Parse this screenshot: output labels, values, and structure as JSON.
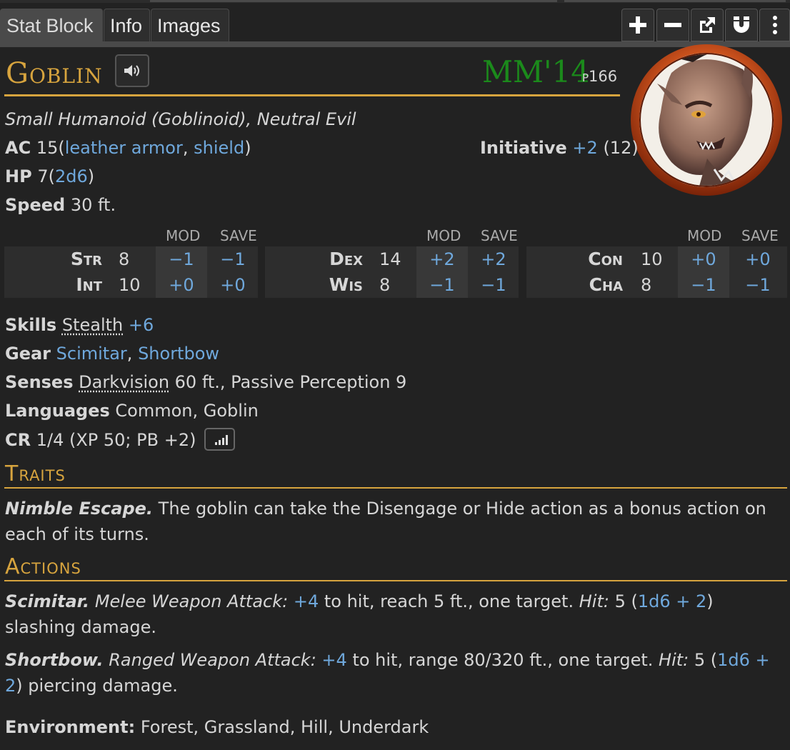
{
  "tabs": [
    {
      "label": "Stat Block"
    },
    {
      "label": "Info"
    },
    {
      "label": "Images"
    }
  ],
  "toolbar": [
    "plus-icon",
    "minus-icon",
    "popout-icon",
    "magnet-icon",
    "kebab-menu-icon"
  ],
  "header": {
    "name": "Goblin",
    "source": "MM'14",
    "page": "p166",
    "source_color": "#1b8a1b",
    "accent_color": "#d7a43e",
    "link_color": "#6fa8dc"
  },
  "type_line": "Small Humanoid (Goblinoid), Neutral Evil",
  "ac": {
    "label": "AC",
    "value": "15",
    "open": "(",
    "item1": "leather armor",
    "sep": ", ",
    "item2": "shield",
    "close": ")"
  },
  "initiative": {
    "label": "Initiative",
    "mod": "+2",
    "passive": "(12)"
  },
  "hp": {
    "label": "HP",
    "value": "7",
    "open": "(",
    "dice": "2d6",
    "close": ")"
  },
  "speed": {
    "label": "Speed",
    "value": "30 ft."
  },
  "ability_headers": {
    "mod": "MOD",
    "save": "SAVE"
  },
  "abilities": [
    [
      {
        "name": "Str",
        "score": "8",
        "mod": "−1",
        "save": "−1"
      },
      {
        "name": "Int",
        "score": "10",
        "mod": "+0",
        "save": "+0"
      }
    ],
    [
      {
        "name": "Dex",
        "score": "14",
        "mod": "+2",
        "save": "+2"
      },
      {
        "name": "Wis",
        "score": "8",
        "mod": "−1",
        "save": "−1"
      }
    ],
    [
      {
        "name": "Con",
        "score": "10",
        "mod": "+0",
        "save": "+0"
      },
      {
        "name": "Cha",
        "score": "8",
        "mod": "−1",
        "save": "−1"
      }
    ]
  ],
  "skills": {
    "label": "Skills",
    "skill": "Stealth",
    "bonus": "+6"
  },
  "gear": {
    "label": "Gear",
    "item1": "Scimitar",
    "sep": ", ",
    "item2": "Shortbow"
  },
  "senses": {
    "label": "Senses",
    "sense": "Darkvision",
    "rest": " 60 ft., Passive Perception 9"
  },
  "languages": {
    "label": "Languages",
    "value": "Common, Goblin"
  },
  "cr": {
    "label": "CR",
    "value": "1/4 (XP 50; PB +2)"
  },
  "traits": {
    "title": "Traits",
    "items": [
      {
        "name": "Nimble Escape.",
        "text": " The goblin can take the Disengage or Hide action as a bonus action on each of its turns."
      }
    ]
  },
  "actions": {
    "title": "Actions",
    "items": [
      {
        "name": "Scimitar.",
        "attack_type": "Melee Weapon Attack:",
        "bonus": "+4",
        "mid": " to hit, reach 5 ft., one target. ",
        "hit_label": "Hit:",
        "avg": " 5 (",
        "dice": "1d6 + 2",
        "tail": ") slashing damage."
      },
      {
        "name": "Shortbow.",
        "attack_type": "Ranged Weapon Attack:",
        "bonus": "+4",
        "mid": " to hit, range 80/320 ft., one target. ",
        "hit_label": "Hit:",
        "avg": " 5 (",
        "dice": "1d6 + 2",
        "tail": ") piercing damage."
      }
    ]
  },
  "environment": {
    "label": "Environment:",
    "value": "Forest, Grassland, Hill, Underdark"
  }
}
